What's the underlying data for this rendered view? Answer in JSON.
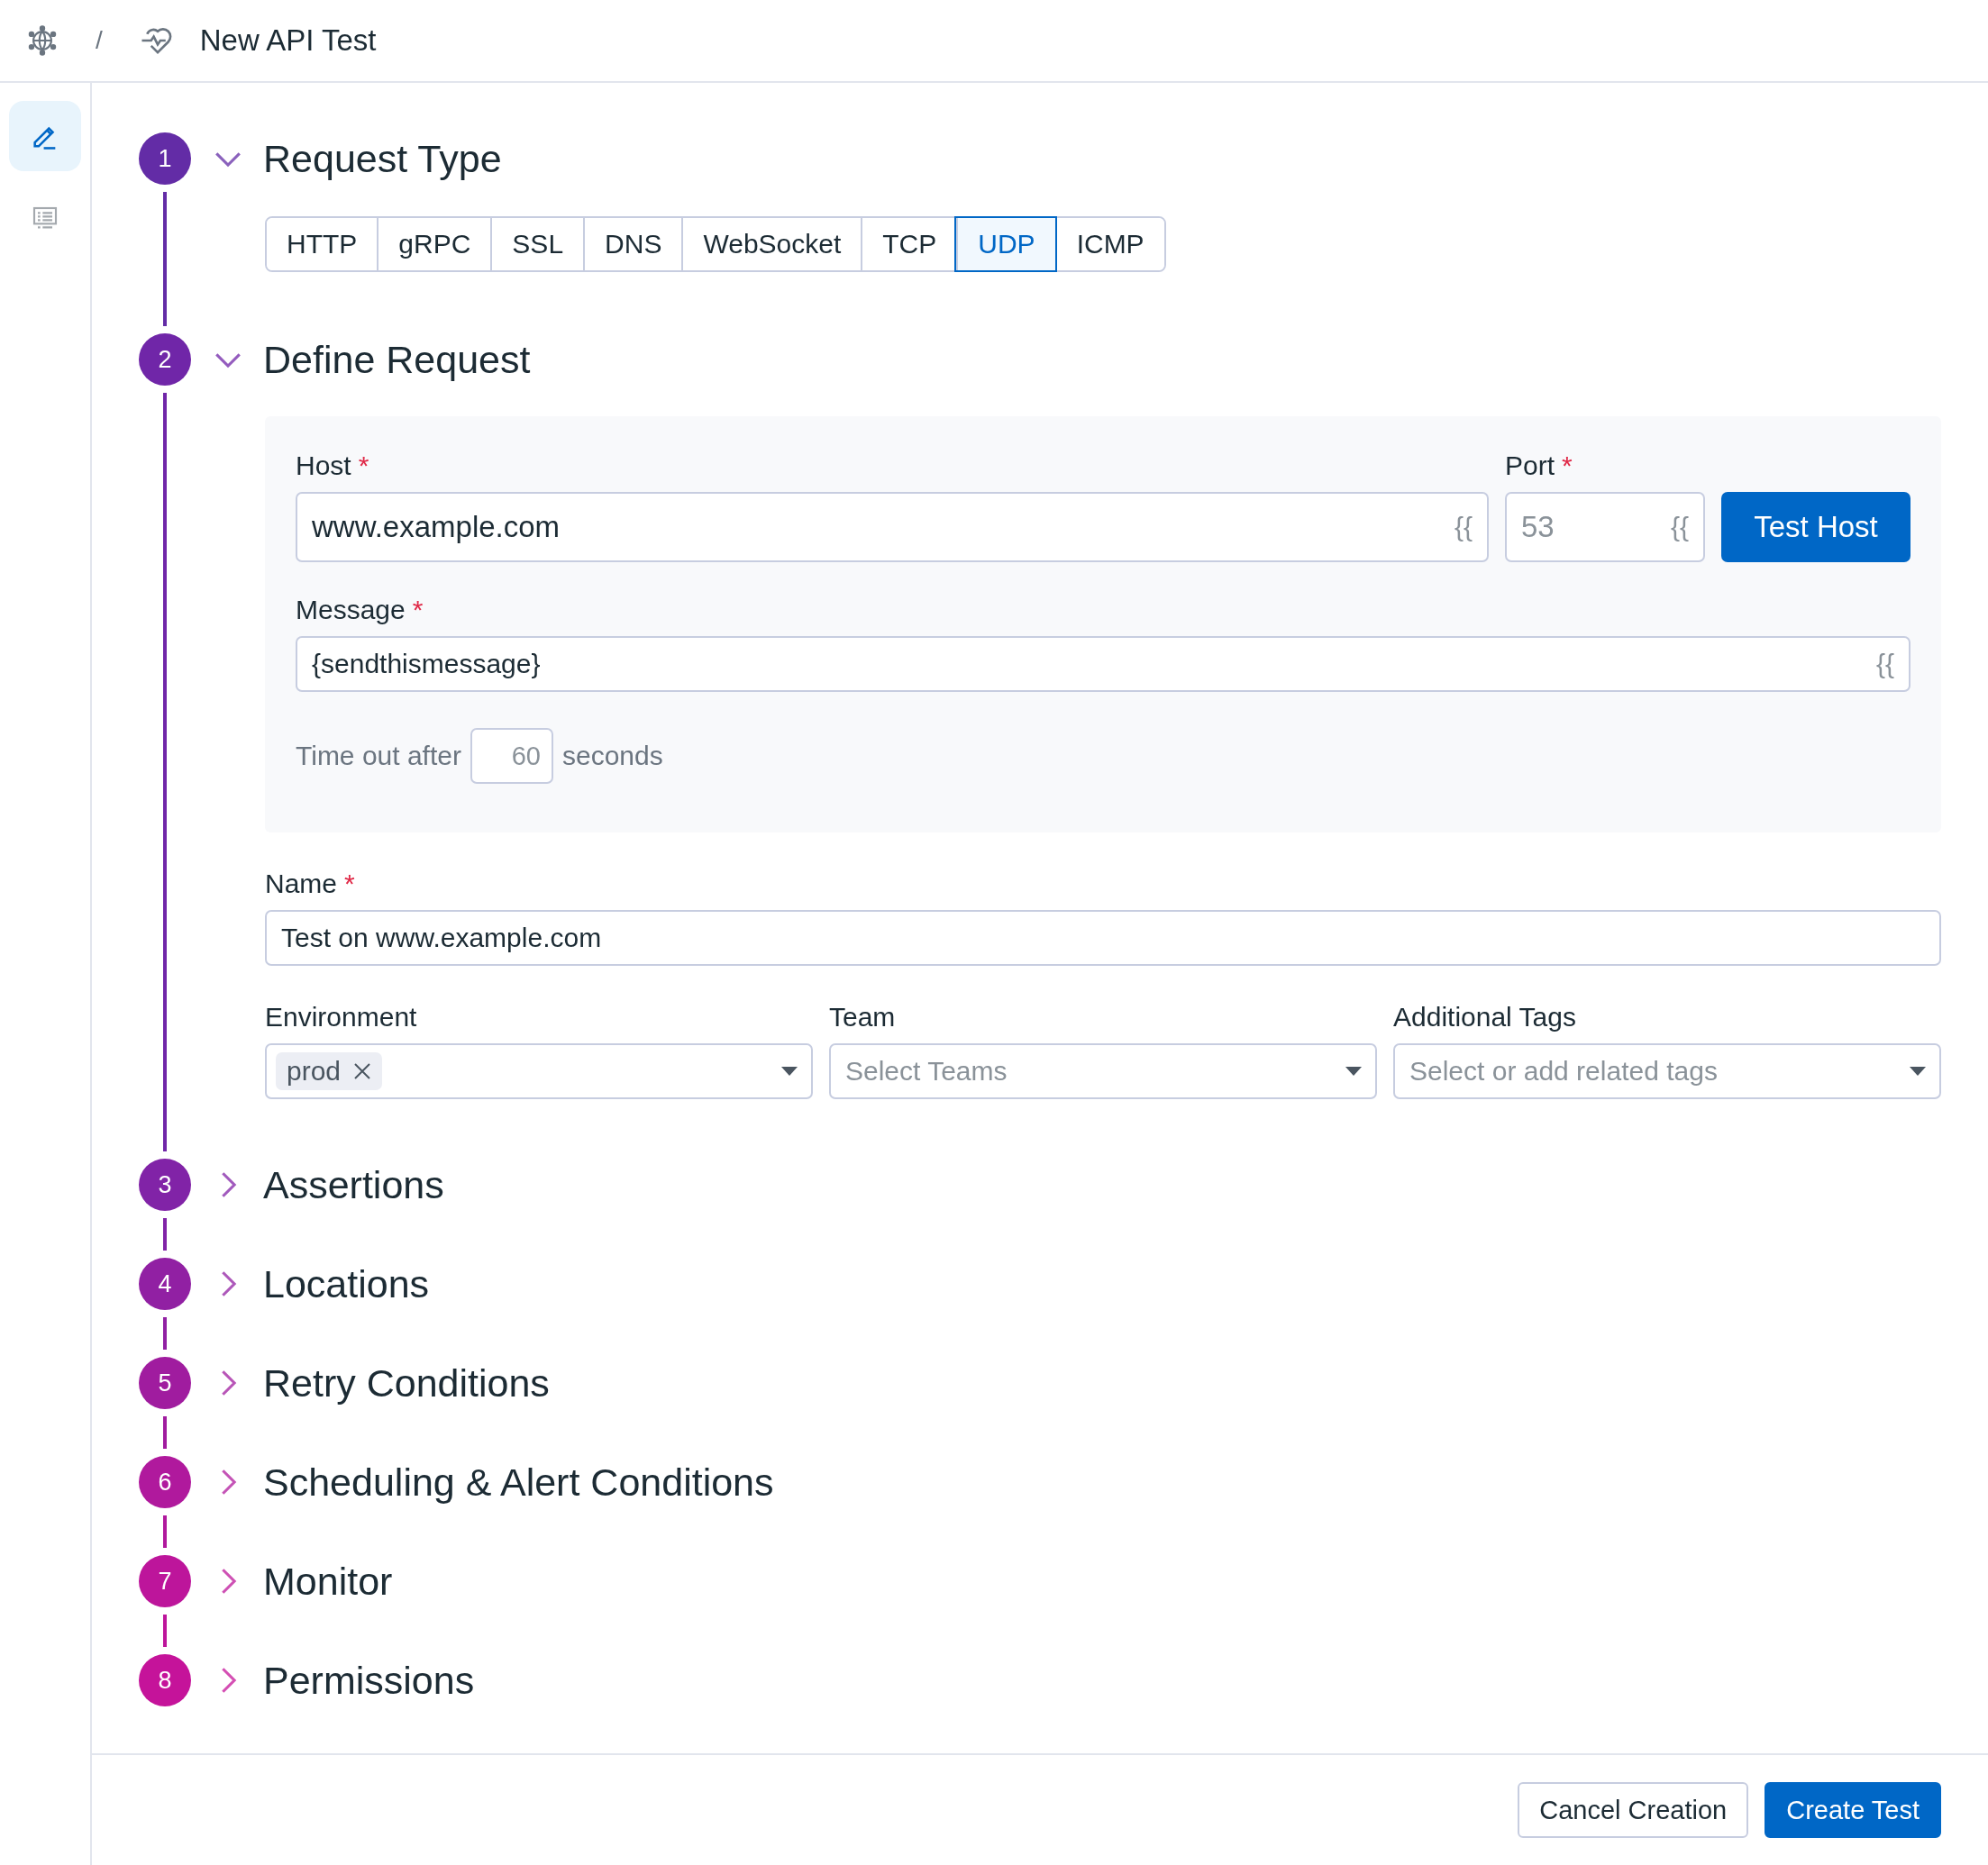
{
  "breadcrumb": {
    "separator": "/",
    "title": "New API Test"
  },
  "sidebar": {
    "items": [
      {
        "kind": "edit",
        "selected": true
      },
      {
        "kind": "list",
        "selected": false
      }
    ]
  },
  "steps": [
    {
      "number": "1",
      "title": "Request Type",
      "expanded": true,
      "color": "#632ca6",
      "kind": "request_type",
      "request_types": [
        {
          "label": "HTTP",
          "selected": false
        },
        {
          "label": "gRPC",
          "selected": false
        },
        {
          "label": "SSL",
          "selected": false
        },
        {
          "label": "DNS",
          "selected": false
        },
        {
          "label": "WebSocket",
          "selected": false
        },
        {
          "label": "TCP",
          "selected": false
        },
        {
          "label": "UDP",
          "selected": true
        },
        {
          "label": "ICMP",
          "selected": false
        }
      ]
    },
    {
      "number": "2",
      "title": "Define Request",
      "expanded": true,
      "color": "#7026a8",
      "kind": "define_request",
      "request": {
        "host": {
          "label": "Host",
          "required_mark": "*",
          "value": "www.example.com",
          "suffix": "{{"
        },
        "port": {
          "label": "Port",
          "required_mark": "*",
          "placeholder": "53",
          "suffix": "{{"
        },
        "test_button": "Test Host",
        "message": {
          "label": "Message",
          "required_mark": "*",
          "value": "{sendthismessage}",
          "suffix": "{{"
        },
        "timeout": {
          "prefix": "Time out after",
          "placeholder": "60",
          "suffix": "seconds"
        }
      },
      "name": {
        "label": "Name",
        "required_mark": "*",
        "value": "Test on www.example.com"
      },
      "selects": [
        {
          "label": "Environment",
          "chips": [
            {
              "label": "prod"
            }
          ]
        },
        {
          "label": "Team",
          "placeholder": "Select Teams"
        },
        {
          "label": "Additional Tags",
          "placeholder": "Select or add related tags"
        }
      ]
    },
    {
      "number": "3",
      "title": "Assertions",
      "expanded": false,
      "color": "#8123a7",
      "kind": "section"
    },
    {
      "number": "4",
      "title": "Locations",
      "expanded": false,
      "color": "#9120a3",
      "kind": "section"
    },
    {
      "number": "5",
      "title": "Retry Conditions",
      "expanded": false,
      "color": "#a01c9f",
      "kind": "section"
    },
    {
      "number": "6",
      "title": "Scheduling & Alert Conditions",
      "expanded": false,
      "color": "#b0199d",
      "kind": "section"
    },
    {
      "number": "7",
      "title": "Monitor",
      "expanded": false,
      "color": "#bd159b",
      "kind": "section"
    },
    {
      "number": "8",
      "title": "Permissions",
      "expanded": false,
      "color": "#c5139a",
      "kind": "section"
    }
  ],
  "footer": {
    "buttons": [
      {
        "label": "Cancel Creation",
        "kind": "secondary"
      },
      {
        "label": "Create Test",
        "kind": "primary"
      }
    ]
  }
}
